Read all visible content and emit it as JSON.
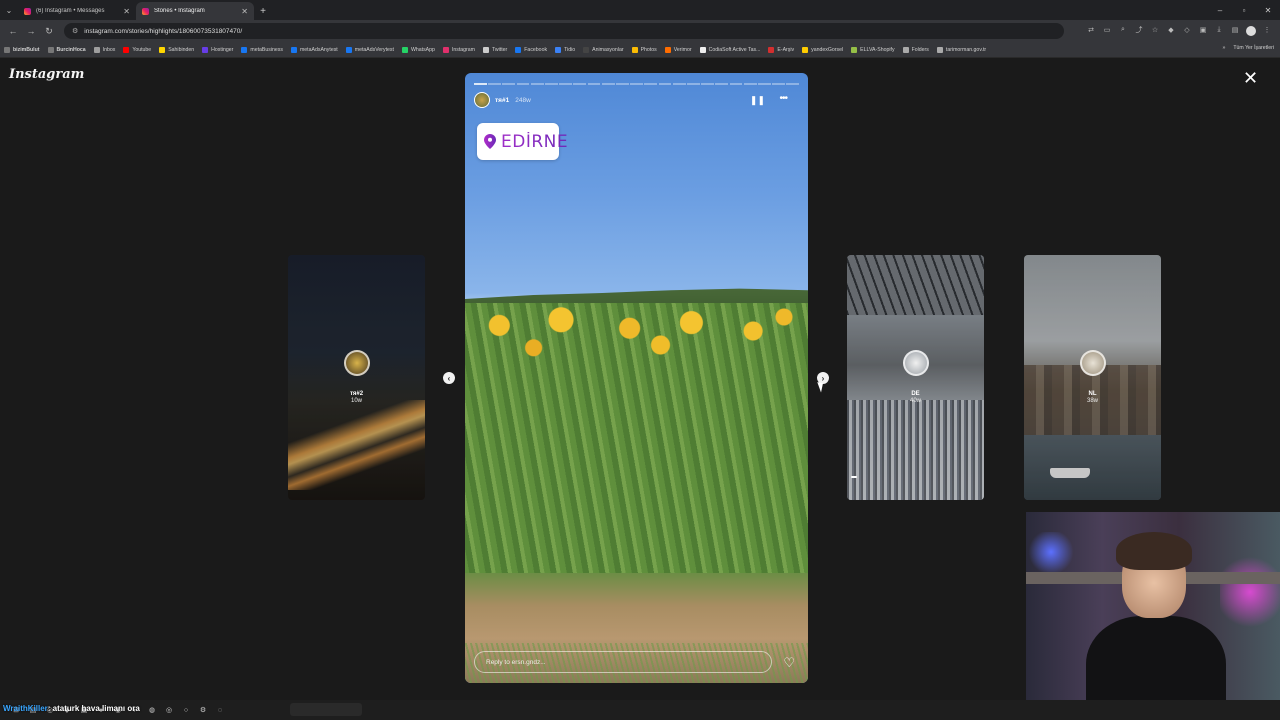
{
  "browser": {
    "tabs": [
      {
        "title": "(6) Instagram • Messages",
        "active": false
      },
      {
        "title": "Stories • Instagram",
        "active": true
      }
    ],
    "url": "instagram.com/stories/highlights/18060073531807470/",
    "bookmarks": [
      {
        "label": "bizimBulut",
        "bold": true,
        "color": "#777777"
      },
      {
        "label": "BurcinHoca",
        "bold": true,
        "color": "#777777"
      },
      {
        "label": "Inbox",
        "bold": false,
        "color": "#9e9e9e"
      },
      {
        "label": "Youtube",
        "bold": false,
        "color": "#ff0000"
      },
      {
        "label": "Sahibinden",
        "bold": false,
        "color": "#ffd600"
      },
      {
        "label": "Hostinger",
        "bold": false,
        "color": "#673de6"
      },
      {
        "label": "metaBusiness",
        "bold": false,
        "color": "#1877f2"
      },
      {
        "label": "metaAdsAnytest",
        "bold": false,
        "color": "#1877f2"
      },
      {
        "label": "metaAdsVerytest",
        "bold": false,
        "color": "#1877f2"
      },
      {
        "label": "WhatsApp",
        "bold": false,
        "color": "#25d366"
      },
      {
        "label": "Instagram",
        "bold": false,
        "color": "#e1306c"
      },
      {
        "label": "Twitter",
        "bold": false,
        "color": "#cccccc"
      },
      {
        "label": "Facebook",
        "bold": false,
        "color": "#1877f2"
      },
      {
        "label": "Tidio",
        "bold": false,
        "color": "#3b82f6"
      },
      {
        "label": "Animasyonlar",
        "bold": false,
        "color": "#444444"
      },
      {
        "label": "Photos",
        "bold": false,
        "color": "#fbbc04"
      },
      {
        "label": "Verimor",
        "bold": false,
        "color": "#ff6d00"
      },
      {
        "label": "CodiaSoft Active Tas...",
        "bold": false,
        "color": "#eeeeee"
      },
      {
        "label": "E-Arşiv",
        "bold": false,
        "color": "#d32f2f"
      },
      {
        "label": "yandexGorsel",
        "bold": false,
        "color": "#ffcc00"
      },
      {
        "label": "ELLVA-Shopify",
        "bold": false,
        "color": "#95bf47"
      },
      {
        "label": "Folders",
        "bold": false,
        "color": "#aaaaaa"
      },
      {
        "label": "tarimorman.gov.tr",
        "bold": false,
        "color": "#aaaaaa"
      }
    ],
    "bookmarks_right": "Tüm Yer İşaretleri"
  },
  "viewer": {
    "logo": "Instagram",
    "main_story": {
      "username": "тя#1",
      "age": "248w",
      "location": "EDİRNE",
      "reply_placeholder": "Reply to ersn.gndz...",
      "progress_segments": 23,
      "progress_viewed": 1
    },
    "side_stories": [
      {
        "name": "тя#2",
        "age": "10w"
      },
      {
        "name": "DE",
        "age": "40w"
      },
      {
        "name": "NL",
        "age": "38w"
      }
    ]
  },
  "taskbar": {
    "ticker_user": "WraithKiller",
    "ticker_message": ": ataturk hava limanı ora"
  },
  "colors": {
    "location_text": "#8a2be2",
    "background": "#1a1a1a"
  }
}
